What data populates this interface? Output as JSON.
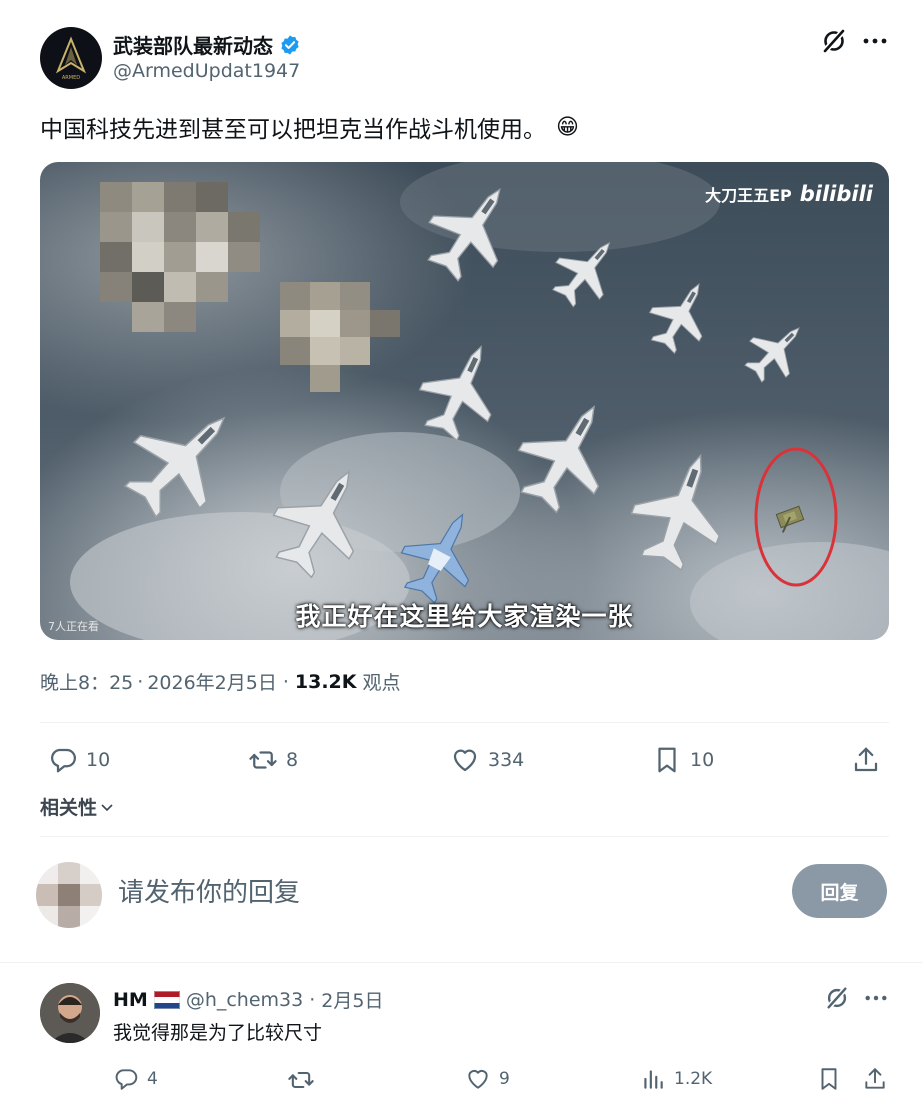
{
  "post": {
    "author_name": "武装部队最新动态",
    "author_handle": "@ArmedUpdat1947",
    "text": "中国科技先进到甚至可以把坦克当作战斗机使用。",
    "emoji": "😁",
    "media": {
      "watermark": "大刀王五EP",
      "watermark_brand": "bilibili",
      "caption": "我正好在这里给大家渲染一张",
      "viewers": "7人正在看"
    },
    "time": "晚上8：25",
    "date": "2026年2月5日",
    "views_count": "13.2K",
    "views_label": "观点"
  },
  "actions": {
    "replies": "10",
    "reposts": "8",
    "likes": "334",
    "bookmarks": "10"
  },
  "relevance_label": "相关性",
  "compose": {
    "placeholder": "请发布你的回复",
    "button_label": "回复"
  },
  "reply": {
    "name": "HM",
    "flag": "netherlands-flag",
    "handle": "@h_chem33",
    "date": "2月5日",
    "text": "我觉得那是为了比较尺寸",
    "replies": "4",
    "likes": "9",
    "views": "1.2K"
  },
  "colors": {
    "verified": "#1d9bf0",
    "muted": "#536471",
    "highlight_circle": "#d9333a"
  },
  "icons": [
    "grok-icon",
    "more-icon",
    "verified-badge-icon",
    "reply-icon",
    "repost-icon",
    "like-icon",
    "bookmark-icon",
    "share-icon",
    "chevron-down-icon",
    "views-icon"
  ]
}
